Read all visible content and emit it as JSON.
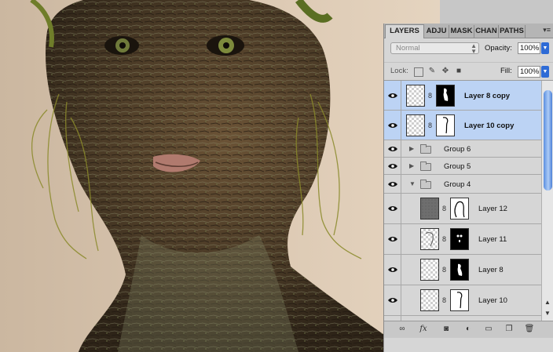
{
  "panel": {
    "tabs": [
      "LAYERS",
      "ADJU",
      "MASK",
      "CHAN",
      "PATHS"
    ],
    "menu_icon": "panel-menu-icon",
    "blend_mode": "Normal",
    "opacity_label": "Opacity:",
    "opacity_value": "100%",
    "lock_label": "Lock:",
    "fill_label": "Fill:",
    "fill_value": "100%"
  },
  "layers": [
    {
      "name": "Layer 8 copy",
      "type": "layer",
      "selected": true
    },
    {
      "name": "Layer 10 copy",
      "type": "layer",
      "selected": true
    },
    {
      "name": "Group 6",
      "type": "group",
      "expanded": false
    },
    {
      "name": "Group 5",
      "type": "group",
      "expanded": false
    },
    {
      "name": "Group 4",
      "type": "group",
      "expanded": true
    },
    {
      "name": "Layer 12",
      "type": "layer"
    },
    {
      "name": "Layer 11",
      "type": "layer"
    },
    {
      "name": "Layer 8",
      "type": "layer"
    },
    {
      "name": "Layer 10",
      "type": "layer"
    }
  ],
  "bottom_icons": [
    "link-layers-icon",
    "fx-icon",
    "add-mask-icon",
    "adjustment-icon",
    "new-group-icon",
    "new-layer-icon",
    "trash-icon"
  ],
  "colors": {
    "selection": "#bcd3f4",
    "scroll_accent": "#2e6bd6",
    "canvas_background": "#e2d2bf"
  }
}
